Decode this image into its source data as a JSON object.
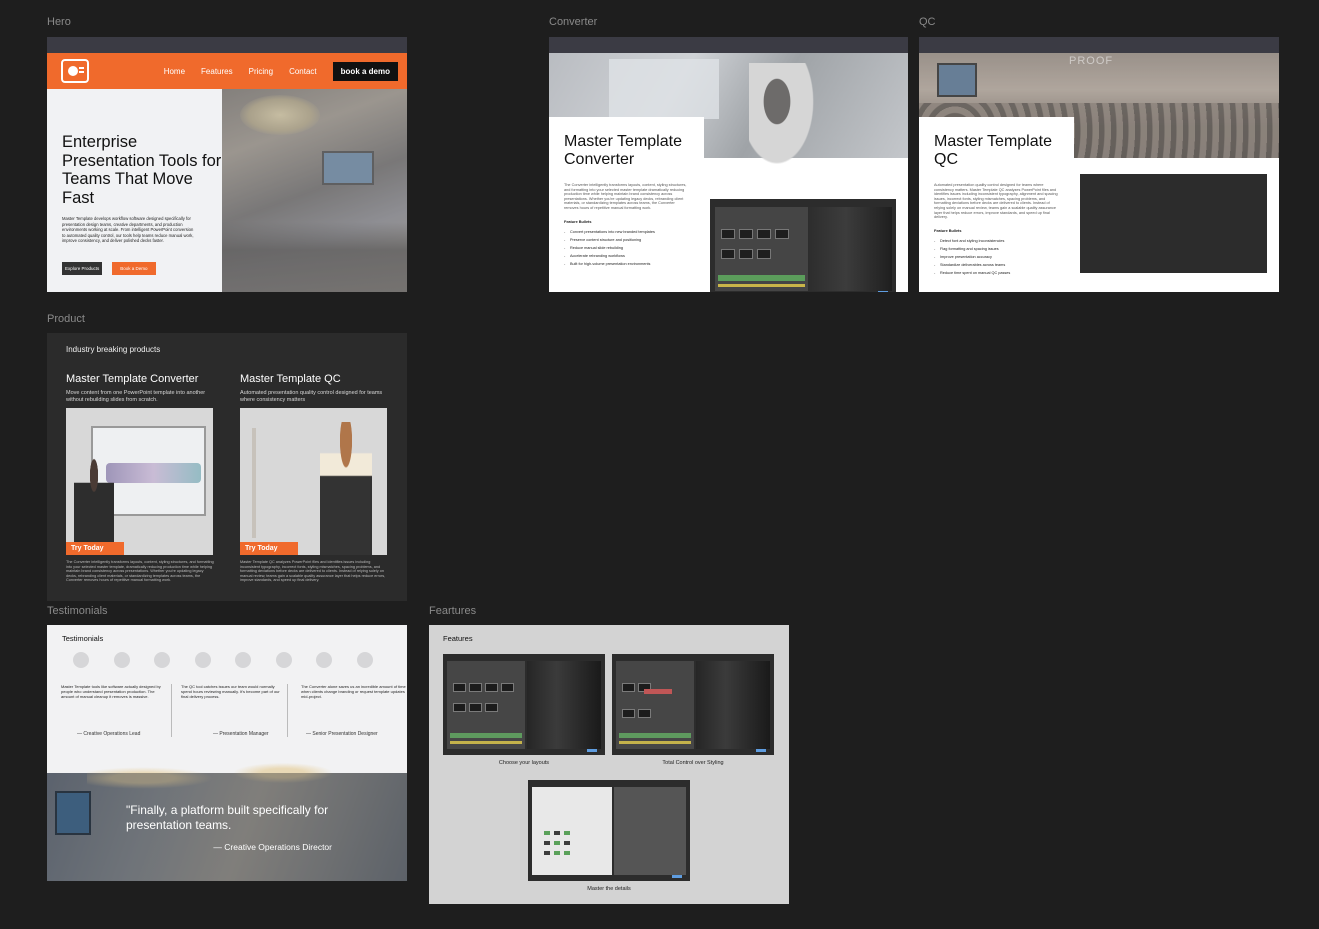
{
  "labels": {
    "hero": "Hero",
    "converter": "Converter",
    "qc": "QC",
    "product": "Product",
    "testimonials": "Testimonials",
    "features": "Feartures"
  },
  "hero": {
    "nav": [
      "Home",
      "Features",
      "Pricing",
      "Contact"
    ],
    "cta": "book a demo",
    "title": "Enterprise Presentation Tools for Teams That Move Fast",
    "description": "Master Template develops workflow software designed specifically for presentation design teams, creative departments, and production environments working at scale. From intelligent PowerPoint conversion to automated quality control, our tools help teams reduce manual work, improve consistency, and deliver polished decks faster.",
    "btn_explore": "Explore Products",
    "btn_demo": "Book a Demo"
  },
  "converter": {
    "title": "Master Template Converter",
    "description": "The Converter intelligently transforms layouts, content, styling structures, and formatting into your selected master template dramatically reducing production time while helping maintain brand consistency across presentations. Whether you're updating legacy decks, rebranding client materials, or standardizing templates across teams, the Converter removes hours of repetitive manual formatting work.",
    "bullets_title": "Feature Bullets",
    "bullets": [
      "Convert presentations into new branded templates",
      "Preserve content structure and positioning",
      "Reduce manual slide rebuilding",
      "Accelerate rebranding workflows",
      "Built for high-volume presentation environments"
    ]
  },
  "qc": {
    "sign": "PROOF",
    "title": "Master Template QC",
    "description": "Automated presentation quality control designed for teams where consistency matters. Master Template QC analyzes PowerPoint files and identifies issues including inconsistent typography, alignment and spacing issues, incorrect fonts, styling mismatches, spacing problems, and formatting deviations before decks are delivered to clients. Instead of relying solely on manual review, teams gain a scalable quality assurance layer that helps reduce errors, improve standards, and speed up final delivery.",
    "bullets_title": "Feature Bullets",
    "bullets": [
      "Detect font and styling inconsistencies",
      "Flag formatting and spacing issues",
      "Improve presentation accuracy",
      "Standardize deliverables across teams",
      "Reduce time spent on manual QC passes"
    ]
  },
  "product": {
    "kicker": "Industry breaking products",
    "cards": [
      {
        "title": "Master Template Converter",
        "subtitle": "Move content from one PowerPoint template into another without rebuilding slides from scratch.",
        "try": "Try Today",
        "long": "The Converter intelligently transforms layouts, content, styling structures, and formatting into your selected master template, dramatically reducing production time while helping maintain brand consistency across presentations. Whether you're updating legacy decks, rebranding client materials, or standardizing templates across teams, the Converter removes hours of repetitive manual formatting work."
      },
      {
        "title": "Master Template QC",
        "subtitle": "Automated presentation quality control designed for teams where consistency matters",
        "try": "Try Today",
        "long": "Master Template QC analyzes PowerPoint files and identifies issues including inconsistent typography, incorrect fonts, styling mismatches, spacing problems, and formatting deviations before decks are delivered to clients. Instead of relying solely on manual review, teams gain a scalable quality assurance layer that helps reduce errors, improve standards, and speed up final delivery."
      }
    ]
  },
  "testimonials": {
    "title": "Testimonials",
    "quotes": [
      {
        "text": "Master Template tools like software actually designed by people who understand presentation production. The amount of manual cleanup it removes is massive.",
        "author": "— Creative Operations Lead"
      },
      {
        "text": "The QC tool catches issues our team would normally spend hours reviewing manually. It's become part of our final delivery process.",
        "author": "— Presentation Manager"
      },
      {
        "text": "The Converter alone saves us an incredible amount of time when clients change branding or request template updates mid-project.",
        "author": "— Senior Presentation Designer"
      }
    ],
    "banner_quote": "\"Finally, a platform built specifically for presentation teams.",
    "banner_author": "— Creative Operations Director"
  },
  "features": {
    "title": "Features",
    "captions": [
      "Choose your layouts",
      "Total Control over Styling",
      "Master the details"
    ]
  },
  "colors": {
    "accent": "#f06a2c",
    "canvas": "#1e1e1e",
    "dark_panel": "#2b2b2b"
  }
}
